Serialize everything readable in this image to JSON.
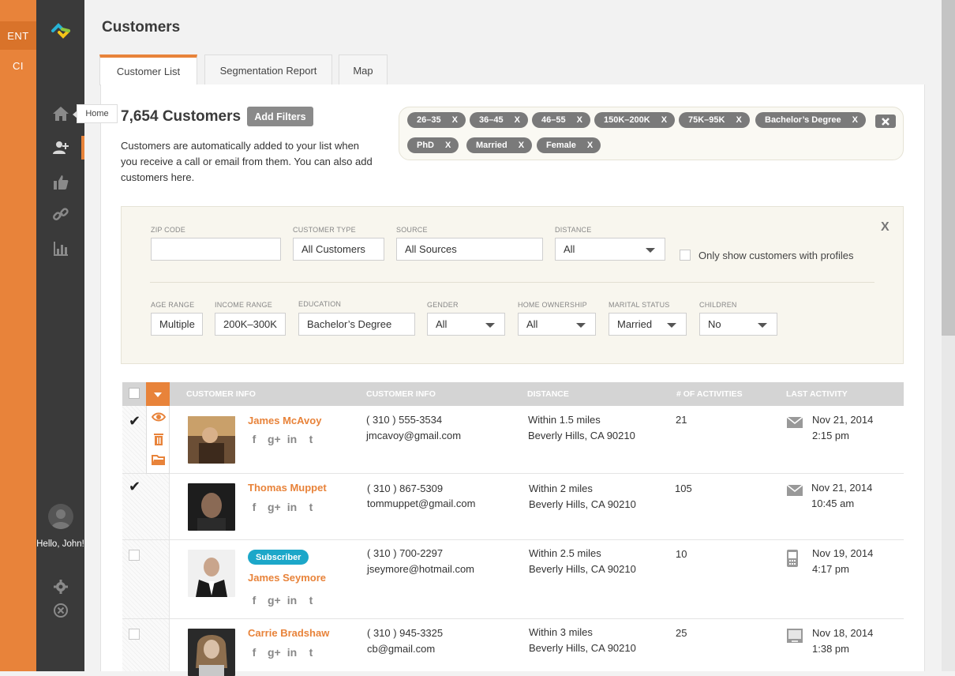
{
  "rail": {
    "ent": "ENT",
    "ci": "CI"
  },
  "nav": {
    "tooltip": "Home",
    "hello": "Hello, John!",
    "icons": [
      "home-icon",
      "customers-icon",
      "thumbs-up-icon",
      "link-icon",
      "bar-chart-icon",
      "gear-icon",
      "close-circle-icon"
    ]
  },
  "colors": {
    "accent": "#e8833a",
    "badge": "#1ca7c9",
    "nav": "#3a3a3a"
  },
  "page": {
    "title": "Customers"
  },
  "tabs": [
    {
      "label": "Customer List",
      "active": true
    },
    {
      "label": "Segmentation Report",
      "active": false
    },
    {
      "label": "Map",
      "active": false
    }
  ],
  "summary": {
    "count_label": "7,654 Customers",
    "add_filters_label": "Add Filters",
    "description": "Customers are automatically added to your list when you receive a call or email from them. You can also add customers here."
  },
  "chips": [
    "26–35",
    "36–45",
    "46–55",
    "150K–200K",
    "75K–95K",
    "Bachelor’s Degree",
    "PhD",
    "Married",
    "Female"
  ],
  "chip_remove": "X",
  "filters": {
    "close_label": "X",
    "zip_code": {
      "label": "ZIP CODE",
      "value": ""
    },
    "customer_type": {
      "label": "CUSTOMER TYPE",
      "value": "All Customers"
    },
    "source": {
      "label": "SOURCE",
      "value": "All Sources"
    },
    "distance": {
      "label": "DISTANCE",
      "value": "All"
    },
    "profiles_only": {
      "label": "Only show customers with profiles",
      "checked": false
    },
    "age_range": {
      "label": "AGE RANGE",
      "value": "Multiple"
    },
    "income_range": {
      "label": "INCOME RANGE",
      "value": "200K–300K"
    },
    "education": {
      "label": "EDUCATION",
      "value": "Bachelor’s Degree"
    },
    "gender": {
      "label": "GENDER",
      "value": "All"
    },
    "home_ownership": {
      "label": "HOME OWNERSHIP",
      "value": "All"
    },
    "marital_status": {
      "label": "MARITAL STATUS",
      "value": "Married"
    },
    "children": {
      "label": "CHILDREN",
      "value": "No"
    }
  },
  "table": {
    "headers": [
      "CUSTOMER INFO",
      "CUSTOMER INFO",
      "DISTANCE",
      "# OF ACTIVITIES",
      "LAST ACTIVITY"
    ],
    "rows": [
      {
        "name": "James McAvoy",
        "badge": "",
        "phone": "( 310 ) 555-3534",
        "email": "jmcavoy@gmail.com",
        "distance": "Within 1.5 miles",
        "location": "Beverly Hills, CA 90210",
        "activities": "21",
        "activity_icon": "email-icon",
        "date": "Nov 21, 2014",
        "time": "2:15 pm",
        "checked": true
      },
      {
        "name": "Thomas Muppet",
        "badge": "",
        "phone": "( 310 ) 867-5309",
        "email": "tommuppet@gmail.com",
        "distance": "Within 2 miles",
        "location": "Beverly Hills, CA 90210",
        "activities": "105",
        "activity_icon": "email-icon",
        "date": "Nov 21, 2014",
        "time": "10:45 am",
        "checked": true
      },
      {
        "name": "James Seymore",
        "badge": "Subscriber",
        "phone": "( 310 ) 700-2297",
        "email": "jseymore@hotmail.com",
        "distance": "Within 2.5 miles",
        "location": "Beverly Hills, CA 90210",
        "activities": "10",
        "activity_icon": "phone-icon",
        "date": "Nov 19, 2014",
        "time": "4:17 pm",
        "checked": false
      },
      {
        "name": "Carrie Bradshaw",
        "badge": "",
        "phone": "( 310 ) 945-3325",
        "email": "cb@gmail.com",
        "distance": "Within 3 miles",
        "location": "Beverly Hills, CA 90210",
        "activities": "25",
        "activity_icon": "web-icon",
        "date": "Nov 18, 2014",
        "time": "1:38 pm",
        "checked": false
      }
    ]
  }
}
